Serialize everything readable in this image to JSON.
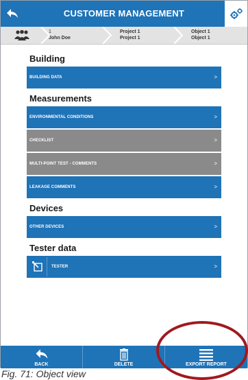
{
  "header": {
    "title": "CUSTOMER MANAGEMENT"
  },
  "breadcrumb": {
    "customer": {
      "line1": "1",
      "line2": "John Doe"
    },
    "project": {
      "line1": "Project 1",
      "line2": "Project 1"
    },
    "object": {
      "line1": "Object 1",
      "line2": "Object 1"
    }
  },
  "sections": {
    "building": {
      "title": "Building",
      "items": [
        {
          "label": "BUILDING DATA",
          "arrow": ">"
        }
      ]
    },
    "measurements": {
      "title": "Measurements",
      "items": [
        {
          "label": "ENVIRONMENTAL CONDITIONS",
          "arrow": ">"
        },
        {
          "label": "CHECKLIST",
          "arrow": ">"
        },
        {
          "label": "MULTI-POINT TEST - COMMENTS",
          "arrow": ">"
        },
        {
          "label": "LEAKAGE COMMENTS",
          "arrow": ">"
        }
      ]
    },
    "devices": {
      "title": "Devices",
      "items": [
        {
          "label": "OTHER DEVICES",
          "arrow": ">"
        }
      ]
    },
    "tester_data": {
      "title": "Tester data",
      "items": [
        {
          "label": "TESTER",
          "arrow": ">"
        }
      ]
    }
  },
  "toolbar": {
    "back_label": "BACK",
    "delete_label": "DELETE",
    "export_label": "EXPORT REPORT"
  },
  "caption": "Fig. 71: Object view",
  "colors": {
    "primary": "#1f73b7",
    "disabled": "#8a8a8a",
    "highlight": "#a0191f"
  }
}
